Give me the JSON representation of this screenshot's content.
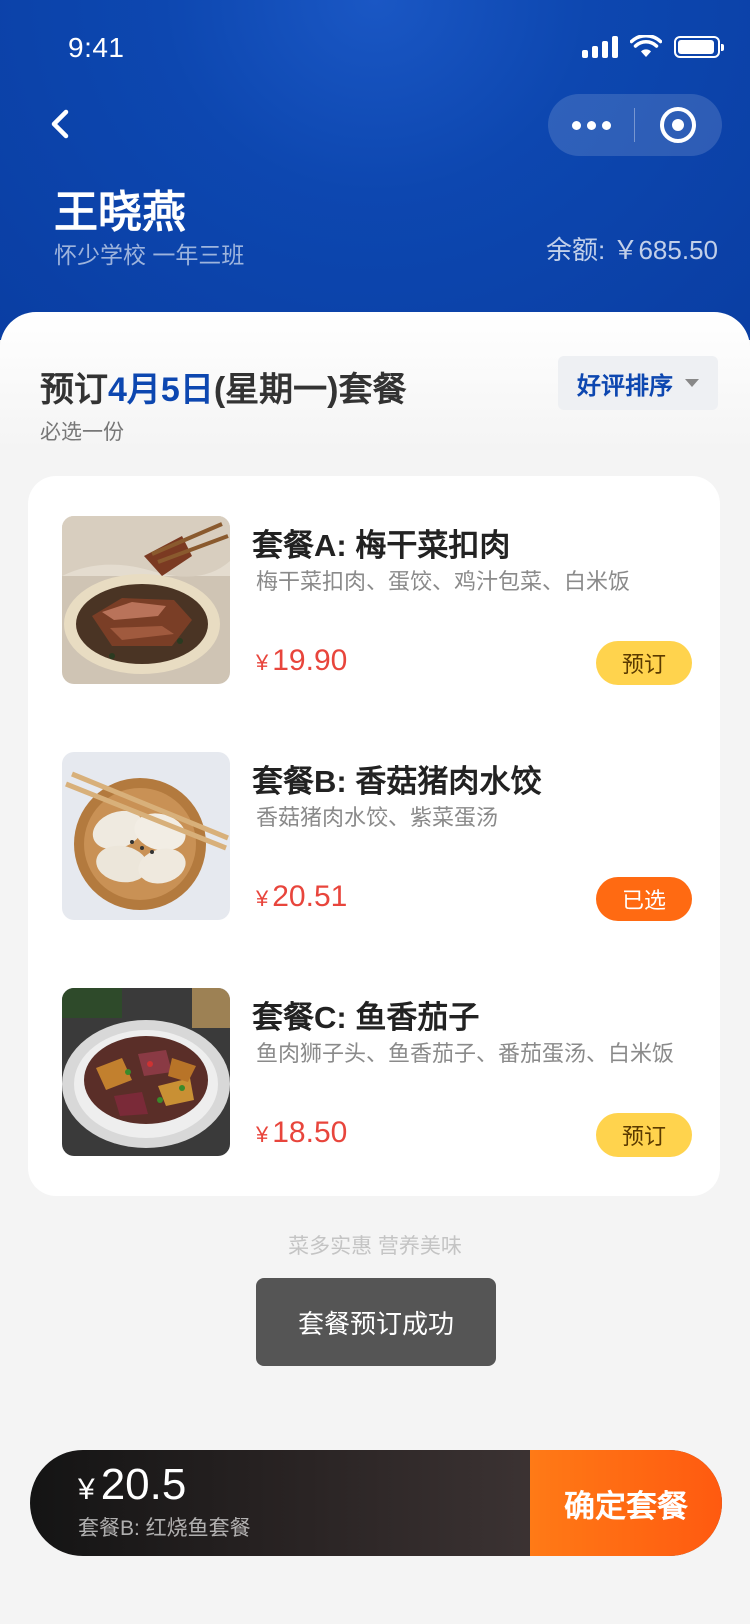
{
  "status_bar": {
    "time": "9:41"
  },
  "user": {
    "name": "王晓燕",
    "school": "怀少学校 一年三班",
    "balance_label": "余额:",
    "balance_value": "￥685.50"
  },
  "plan": {
    "title_prefix": "预订",
    "title_date": "4月5日",
    "title_suffix": "(星期一)套餐",
    "subtitle": "必选一份",
    "sort_label": "好评排序"
  },
  "meals": [
    {
      "name": "套餐A: 梅干菜扣肉",
      "desc": "梅干菜扣肉、蛋饺、鸡汁包菜、白米饭",
      "currency": "¥",
      "price": "19.90",
      "action": "预订",
      "selected": false,
      "image": "braised-pork-photo"
    },
    {
      "name": "套餐B: 香菇猪肉水饺",
      "desc": "香菇猪肉水饺、紫菜蛋汤",
      "currency": "¥",
      "price": "20.51",
      "action": "已选",
      "selected": true,
      "image": "dumplings-photo"
    },
    {
      "name": "套餐C: 鱼香茄子",
      "desc": "鱼肉狮子头、鱼香茄子、番茄蛋汤、白米饭",
      "currency": "¥",
      "price": "18.50",
      "action": "预订",
      "selected": false,
      "image": "eggplant-photo"
    }
  ],
  "slogan": "菜多实惠 营养美味",
  "toast": "套餐预订成功",
  "bottom": {
    "currency": "¥",
    "total": "20.5",
    "package": "套餐B: 红烧鱼套餐",
    "confirm_label": "确定套餐"
  },
  "colors": {
    "header_blue": "#0d47b0",
    "price_red": "#e8453c",
    "book_yellow": "#ffd34d",
    "selected_orange": "#ff6a12"
  }
}
